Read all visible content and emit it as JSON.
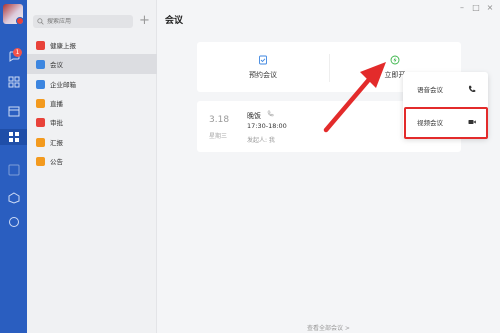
{
  "rail": {
    "badge_count": "1",
    "icons": [
      "avatar",
      "message-icon",
      "contacts-icon",
      "calendar-icon",
      "workbench-icon",
      "docs-icon",
      "drive-icon",
      "cloud-icon"
    ]
  },
  "sidebar": {
    "search_placeholder": "搜索应用",
    "add_label": "+",
    "items": [
      {
        "label": "健康上报",
        "color": "#e8423a",
        "icon": "health-report-icon"
      },
      {
        "label": "会议",
        "color": "#3d86e0",
        "icon": "meeting-icon"
      },
      {
        "label": "企业邮箱",
        "color": "#3d86e0",
        "icon": "mail-icon"
      },
      {
        "label": "直播",
        "color": "#f39a1e",
        "icon": "live-icon"
      },
      {
        "label": "审批",
        "color": "#e8423a",
        "icon": "approval-icon"
      },
      {
        "label": "汇报",
        "color": "#f39a1e",
        "icon": "report-icon"
      },
      {
        "label": "公告",
        "color": "#f39a1e",
        "icon": "announcement-icon"
      }
    ],
    "selected_index": 1
  },
  "main": {
    "title": "会议",
    "actions": [
      {
        "label": "预约会议",
        "icon": "schedule-meeting-icon"
      },
      {
        "label": "立即开",
        "icon": "start-now-icon"
      }
    ],
    "meeting": {
      "date": "3.18",
      "weekday": "星期三",
      "title": "晚饭",
      "time": "17:30-18:00",
      "host": "发起人: 我"
    },
    "view_all": "查看全部会议 >"
  },
  "dropdown": {
    "items": [
      {
        "label": "语音会议",
        "icon": "phone-icon"
      },
      {
        "label": "视频会议",
        "icon": "video-icon"
      }
    ]
  },
  "colors": {
    "rail": "#2a5ec0",
    "accent": "#3d86e0",
    "annotation": "#e32b2b"
  }
}
